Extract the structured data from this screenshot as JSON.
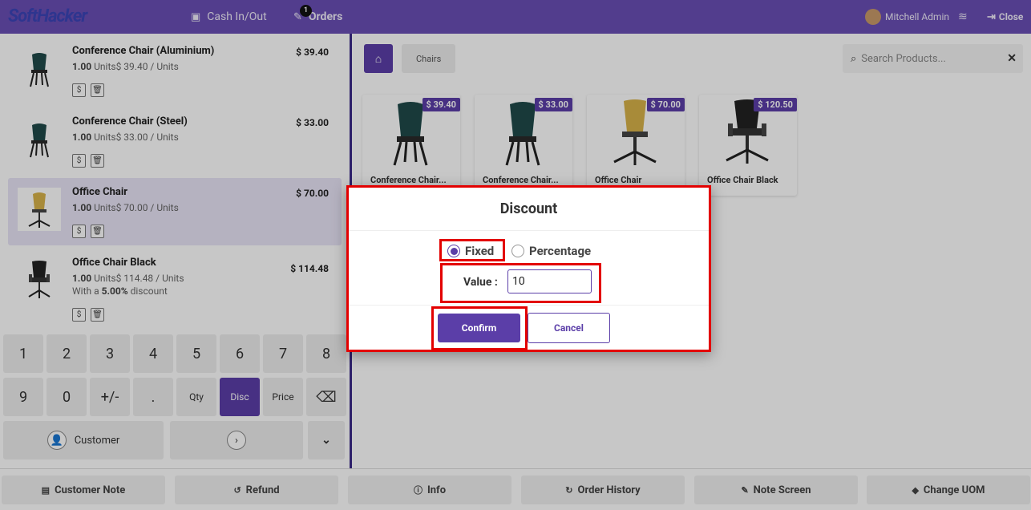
{
  "topbar": {
    "logo": "SoftHacker",
    "cash_label": "Cash In/Out",
    "orders_label": "Orders",
    "orders_badge": "1",
    "user_name": "Mitchell Admin",
    "close_label": "Close"
  },
  "order_lines": [
    {
      "name": "Conference Chair (Aluminium)",
      "price": "$ 39.40",
      "qty": "1.00",
      "unit_text": "Units$ 39.40 / Units",
      "discount": ""
    },
    {
      "name": "Conference Chair (Steel)",
      "price": "$ 33.00",
      "qty": "1.00",
      "unit_text": "Units$ 33.00 / Units",
      "discount": ""
    },
    {
      "name": "Office Chair",
      "price": "$ 70.00",
      "qty": "1.00",
      "unit_text": "Units$ 70.00 / Units",
      "discount": ""
    },
    {
      "name": "Office Chair Black",
      "price": "$ 114.48",
      "qty": "1.00",
      "unit_text": "Units$ 114.48 / Units",
      "discount_prefix": "With a ",
      "discount_value": "5.00%",
      "discount_suffix": " discount"
    }
  ],
  "numpad": {
    "row1": [
      "1",
      "2",
      "3",
      "4",
      "5",
      "6",
      "7",
      "8"
    ],
    "row2": [
      "9",
      "0",
      "+/-",
      ".",
      "Qty",
      "Disc",
      "Price",
      "⌫"
    ],
    "customer_label": "Customer"
  },
  "products": {
    "category": "Chairs",
    "search_placeholder": "Search Products...",
    "items": [
      {
        "name": "Conference Chair...",
        "price": "$ 39.40"
      },
      {
        "name": "Conference Chair...",
        "price": "$ 33.00"
      },
      {
        "name": "Office Chair",
        "price": "$ 70.00"
      },
      {
        "name": "Office Chair Black",
        "price": "$ 120.50"
      }
    ]
  },
  "footer": {
    "buttons": [
      "Customer Note",
      "Refund",
      "Info",
      "Order History",
      "Note Screen",
      "Change UOM"
    ]
  },
  "dialog": {
    "title": "Discount",
    "fixed_label": "Fixed",
    "percentage_label": "Percentage",
    "selected": "Fixed",
    "value_label": "Value :",
    "value": "10",
    "confirm_label": "Confirm",
    "cancel_label": "Cancel"
  },
  "colors": {
    "primary": "#6a4fb5",
    "accent": "#5b3ea8",
    "highlight": "#e30000"
  }
}
